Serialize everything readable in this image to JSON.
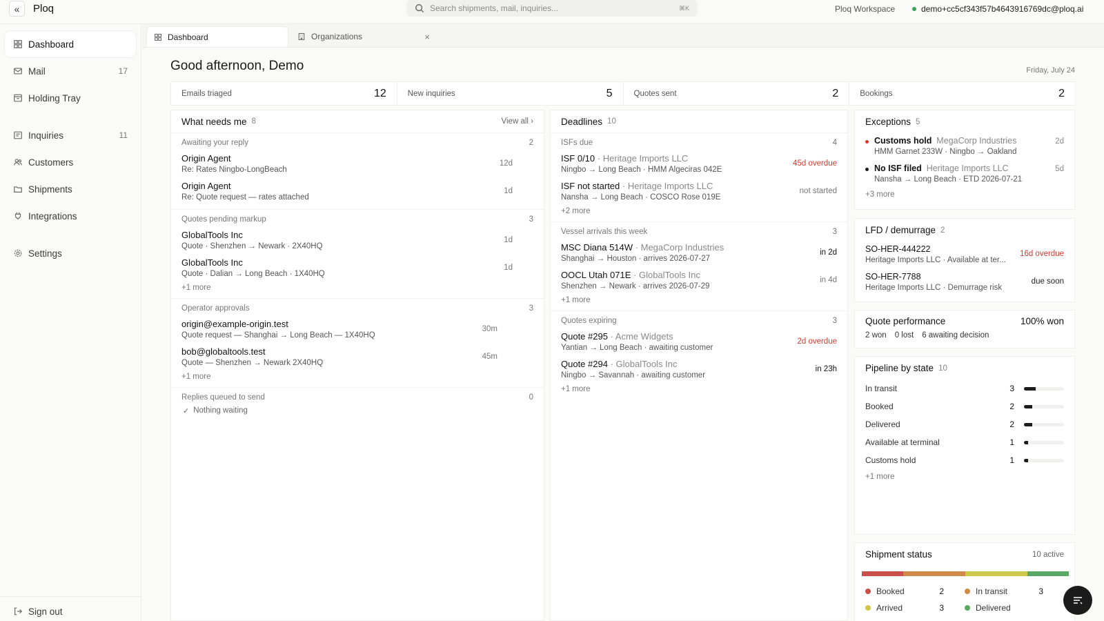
{
  "app": {
    "brand": "Ploq",
    "workspace": "Ploq Workspace",
    "user": "demo+cc5cf343f57b4643916769dc@ploq.ai",
    "search": {
      "placeholder": "Search shipments, mail, inquiries...",
      "shortcut": "⌘K"
    }
  },
  "sidebar": {
    "items": [
      {
        "label": "Dashboard",
        "icon": "grid-icon",
        "count": ""
      },
      {
        "label": "Mail",
        "icon": "mail-icon",
        "count": "17"
      },
      {
        "label": "Holding Tray",
        "icon": "tray-icon",
        "count": ""
      },
      {
        "label": "Inquiries",
        "icon": "inquiry-icon",
        "count": "11"
      },
      {
        "label": "Customers",
        "icon": "users-icon",
        "count": ""
      },
      {
        "label": "Shipments",
        "icon": "folder-icon",
        "count": ""
      },
      {
        "label": "Integrations",
        "icon": "plug-icon",
        "count": ""
      },
      {
        "label": "Settings",
        "icon": "gear-icon",
        "count": ""
      }
    ],
    "signout": "Sign out"
  },
  "tabs": [
    {
      "label": "Dashboard",
      "icon": "grid-icon"
    },
    {
      "label": "Organizations",
      "icon": "building-icon"
    }
  ],
  "main": {
    "greeting": "Good afternoon, Demo",
    "date": "Friday, July 24",
    "stats": [
      {
        "label": "Emails triaged",
        "value": "12"
      },
      {
        "label": "New inquiries",
        "value": "5"
      },
      {
        "label": "Quotes sent",
        "value": "2"
      },
      {
        "label": "Bookings",
        "value": "2"
      }
    ]
  },
  "needs": {
    "title": "What needs me",
    "count": "8",
    "view_all": "View all",
    "groups": [
      {
        "title": "Awaiting your reply",
        "count": "2",
        "rows": [
          {
            "title": "Origin Agent",
            "sub": "Re: Rates Ningbo-LongBeach",
            "age": "12d"
          },
          {
            "title": "Origin Agent",
            "sub": "Re: Quote request — rates attached",
            "age": "1d"
          }
        ],
        "more": ""
      },
      {
        "title": "Quotes pending markup",
        "count": "3",
        "rows": [
          {
            "title": "GlobalTools Inc",
            "sub": "Quote · Shenzhen → Newark · 2X40HQ",
            "age": "1d"
          },
          {
            "title": "GlobalTools Inc",
            "sub": "Quote · Dalian → Long Beach · 1X40HQ",
            "age": "1d"
          }
        ],
        "more": "+1 more"
      },
      {
        "title": "Operator approvals",
        "count": "3",
        "rows": [
          {
            "title": "origin@example-origin.test",
            "sub": "Quote request — Shanghai → Long Beach — 1X40HQ",
            "age": "30m"
          },
          {
            "title": "bob@globaltools.test",
            "sub": "Quote — Shenzhen → Newark 2X40HQ",
            "age": "45m"
          }
        ],
        "more": "+1 more"
      },
      {
        "title": "Replies queued to send",
        "count": "0",
        "rows": [],
        "more": "",
        "empty": "Nothing waiting"
      }
    ]
  },
  "deadlines": {
    "title": "Deadlines",
    "count": "10",
    "groups": [
      {
        "title": "ISFs due",
        "count": "4",
        "rows": [
          {
            "title": "ISF 0/10",
            "party": "Heritage Imports LLC",
            "sub": "Ningbo → Long Beach · HMM Algeciras 042E",
            "status": "45d overdue",
            "overdue": true
          },
          {
            "title": "ISF not started",
            "party": "Heritage Imports LLC",
            "sub": "Nansha → Long Beach · COSCO Rose 019E",
            "status": "not started",
            "overdue": false
          }
        ],
        "more": "+2 more"
      },
      {
        "title": "Vessel arrivals this week",
        "count": "3",
        "rows": [
          {
            "title": "MSC Diana 514W",
            "party": "MegaCorp Industries",
            "sub": "Shanghai → Houston · arrives 2026-07-27",
            "status": "in 2d",
            "overdue": false,
            "dark": true
          },
          {
            "title": "OOCL Utah 071E",
            "party": "GlobalTools Inc",
            "sub": "Shenzhen → Newark · arrives 2026-07-29",
            "status": "in 4d",
            "overdue": false
          }
        ],
        "more": "+1 more"
      },
      {
        "title": "Quotes expiring",
        "count": "3",
        "rows": [
          {
            "title": "Quote #295",
            "party": "Acme Widgets",
            "sub": "Yantian → Long Beach · awaiting customer",
            "status": "2d overdue",
            "overdue": true
          },
          {
            "title": "Quote #294",
            "party": "GlobalTools Inc",
            "sub": "Ningbo → Savannah · awaiting customer",
            "status": "in 23h",
            "overdue": false,
            "dark": true
          }
        ],
        "more": "+1 more"
      }
    ]
  },
  "exceptions": {
    "title": "Exceptions",
    "count": "5",
    "rows": [
      {
        "title": "Customs hold",
        "party": "MegaCorp Industries",
        "sub": "HMM Garnet 233W · Ningbo → Oakland",
        "age": "2d",
        "color": "#d33a2c"
      },
      {
        "title": "No ISF filed",
        "party": "Heritage Imports LLC",
        "sub": "Nansha → Long Beach · ETD 2026-07-21",
        "age": "5d",
        "color": "#1c1c1c"
      }
    ],
    "more": "+3 more"
  },
  "lfd": {
    "title": "LFD / demurrage",
    "count": "2",
    "rows": [
      {
        "title": "SO-HER-444222",
        "sub": "Heritage Imports LLC · Available at ter...",
        "status": "16d overdue",
        "overdue": true
      },
      {
        "title": "SO-HER-7788",
        "sub": "Heritage Imports LLC · Demurrage risk",
        "status": "due soon",
        "overdue": false
      }
    ]
  },
  "quote_perf": {
    "title": "Quote performance",
    "won_pct": "100% won",
    "won": "2 won",
    "lost": "0 lost",
    "awaiting": "6 awaiting decision"
  },
  "pipeline": {
    "title": "Pipeline by state",
    "count": "10",
    "max": 10,
    "rows": [
      {
        "label": "In transit",
        "value": 3
      },
      {
        "label": "Booked",
        "value": 2
      },
      {
        "label": "Delivered",
        "value": 2
      },
      {
        "label": "Available at terminal",
        "value": 1
      },
      {
        "label": "Customs hold",
        "value": 1
      }
    ],
    "more": "+1 more"
  },
  "shipment_status": {
    "title": "Shipment status",
    "active": "10 active",
    "segments": [
      {
        "label": "Booked",
        "value": 2,
        "color": "#c9504a"
      },
      {
        "label": "In transit",
        "value": 3,
        "color": "#cf8a4a"
      },
      {
        "label": "Arrived",
        "value": 3,
        "color": "#cfc94a"
      },
      {
        "label": "Delivered",
        "value": 2,
        "color": "#5aa865"
      }
    ],
    "legend": [
      {
        "label": "Booked",
        "value": "2",
        "color": "#c9504a"
      },
      {
        "label": "In transit",
        "value": "3",
        "color": "#cf8a4a"
      },
      {
        "label": "Arrived",
        "value": "3",
        "color": "#cfc94a"
      },
      {
        "label": "Delivered",
        "value": "",
        "color": "#5aa865"
      }
    ]
  }
}
